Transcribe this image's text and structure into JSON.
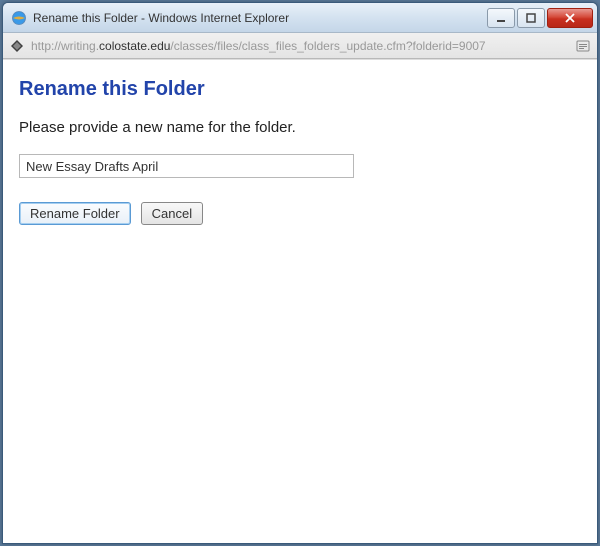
{
  "window": {
    "title": "Rename this Folder - Windows Internet Explorer"
  },
  "address": {
    "prefix": "http://writing.",
    "domain": "colostate.edu",
    "path": "/classes/files/class_files_folders_update.cfm?folderid=9007"
  },
  "page": {
    "heading": "Rename this Folder",
    "instruction": "Please provide a new name for the folder.",
    "folder_name_value": "New Essay Drafts April"
  },
  "buttons": {
    "rename": "Rename Folder",
    "cancel": "Cancel"
  }
}
